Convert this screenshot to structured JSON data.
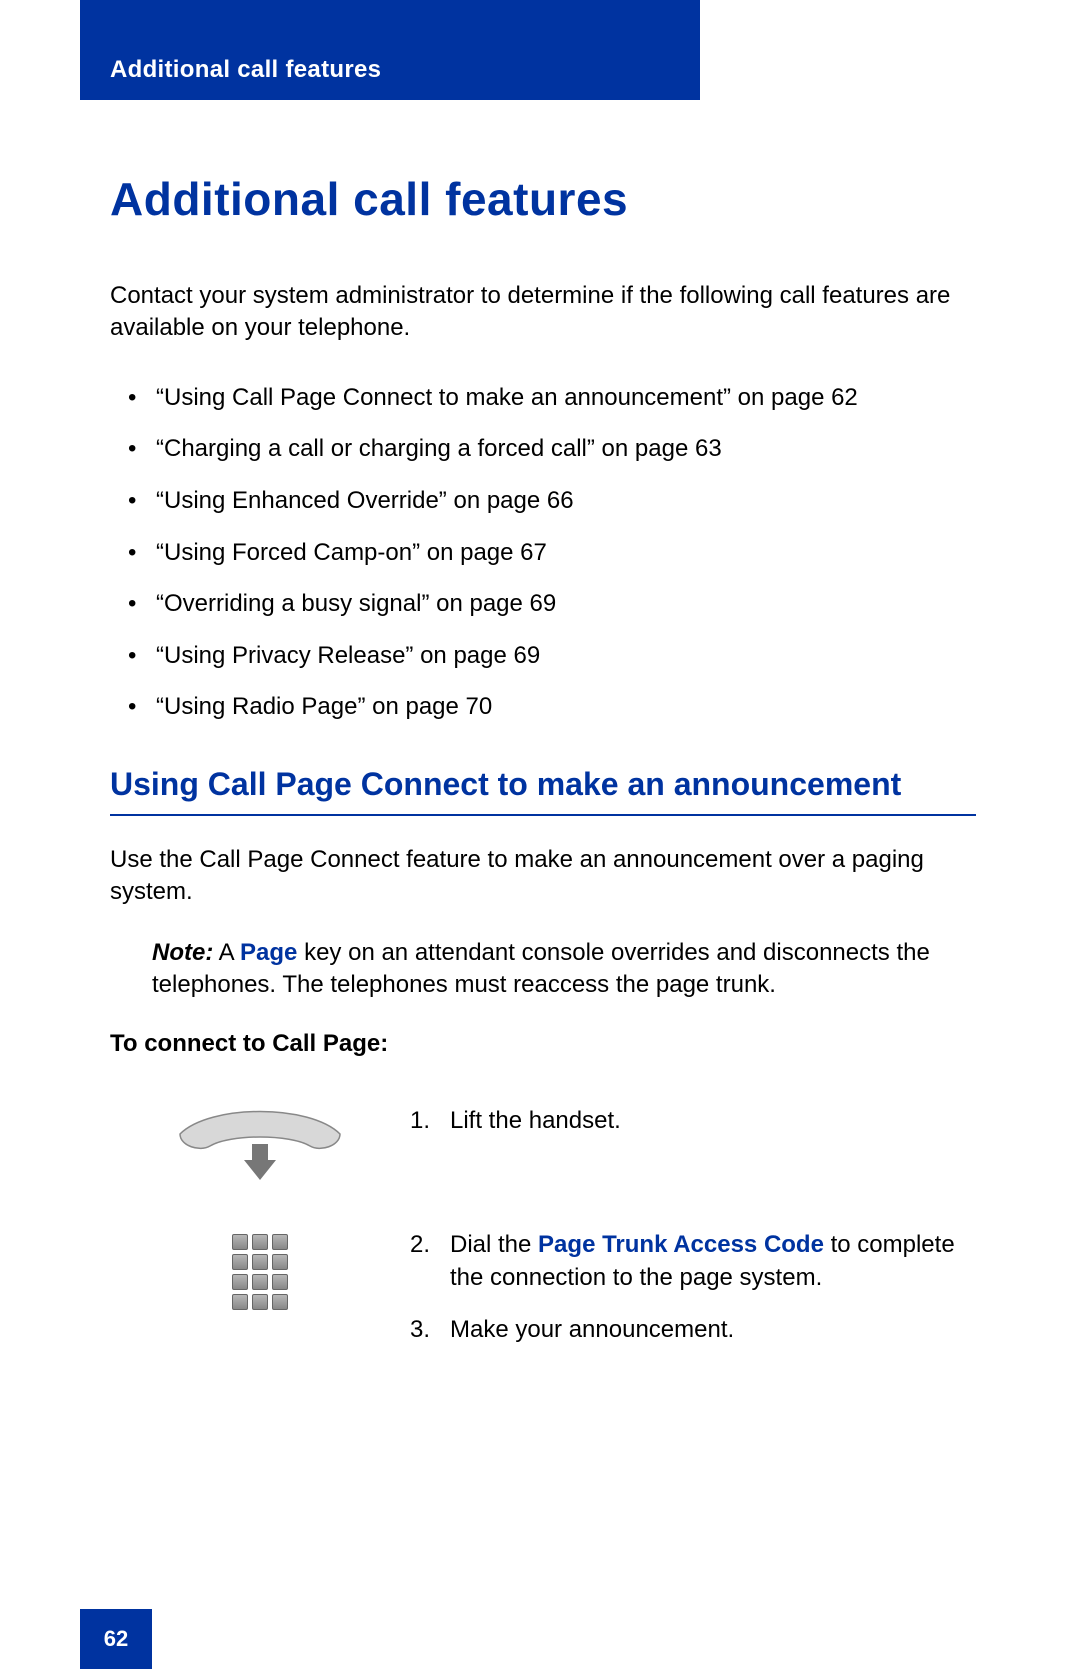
{
  "colors": {
    "brand_blue": "#0033a0"
  },
  "header": {
    "running_title": "Additional call features"
  },
  "title": "Additional call features",
  "intro": "Contact your system administrator to determine if the following call features are available on your telephone.",
  "topics": [
    "“Using Call Page Connect to make an announcement” on page 62",
    "“Charging a call or charging a forced call” on page 63",
    "“Using Enhanced Override” on page 66",
    "“Using Forced Camp-on” on page 67",
    "“Overriding a busy signal” on page 69",
    "“Using Privacy Release” on page 69",
    "“Using Radio Page” on page 70"
  ],
  "section": {
    "heading": "Using Call Page Connect to make an announcement",
    "body": "Use the Call Page Connect feature to make an announcement over a paging system.",
    "note": {
      "label": "Note:",
      "pre": " A ",
      "emph": "Page",
      "post": " key on an attendant console overrides and disconnects the telephones. The telephones must reaccess the page trunk."
    },
    "instr_heading": "To connect to Call Page:",
    "step1": "Lift the handset.",
    "step2_pre": "Dial the ",
    "step2_emph": "Page Trunk Access Code",
    "step2_post": " to complete the connection to the page system.",
    "step3": "Make your announcement."
  },
  "page_number": "62"
}
